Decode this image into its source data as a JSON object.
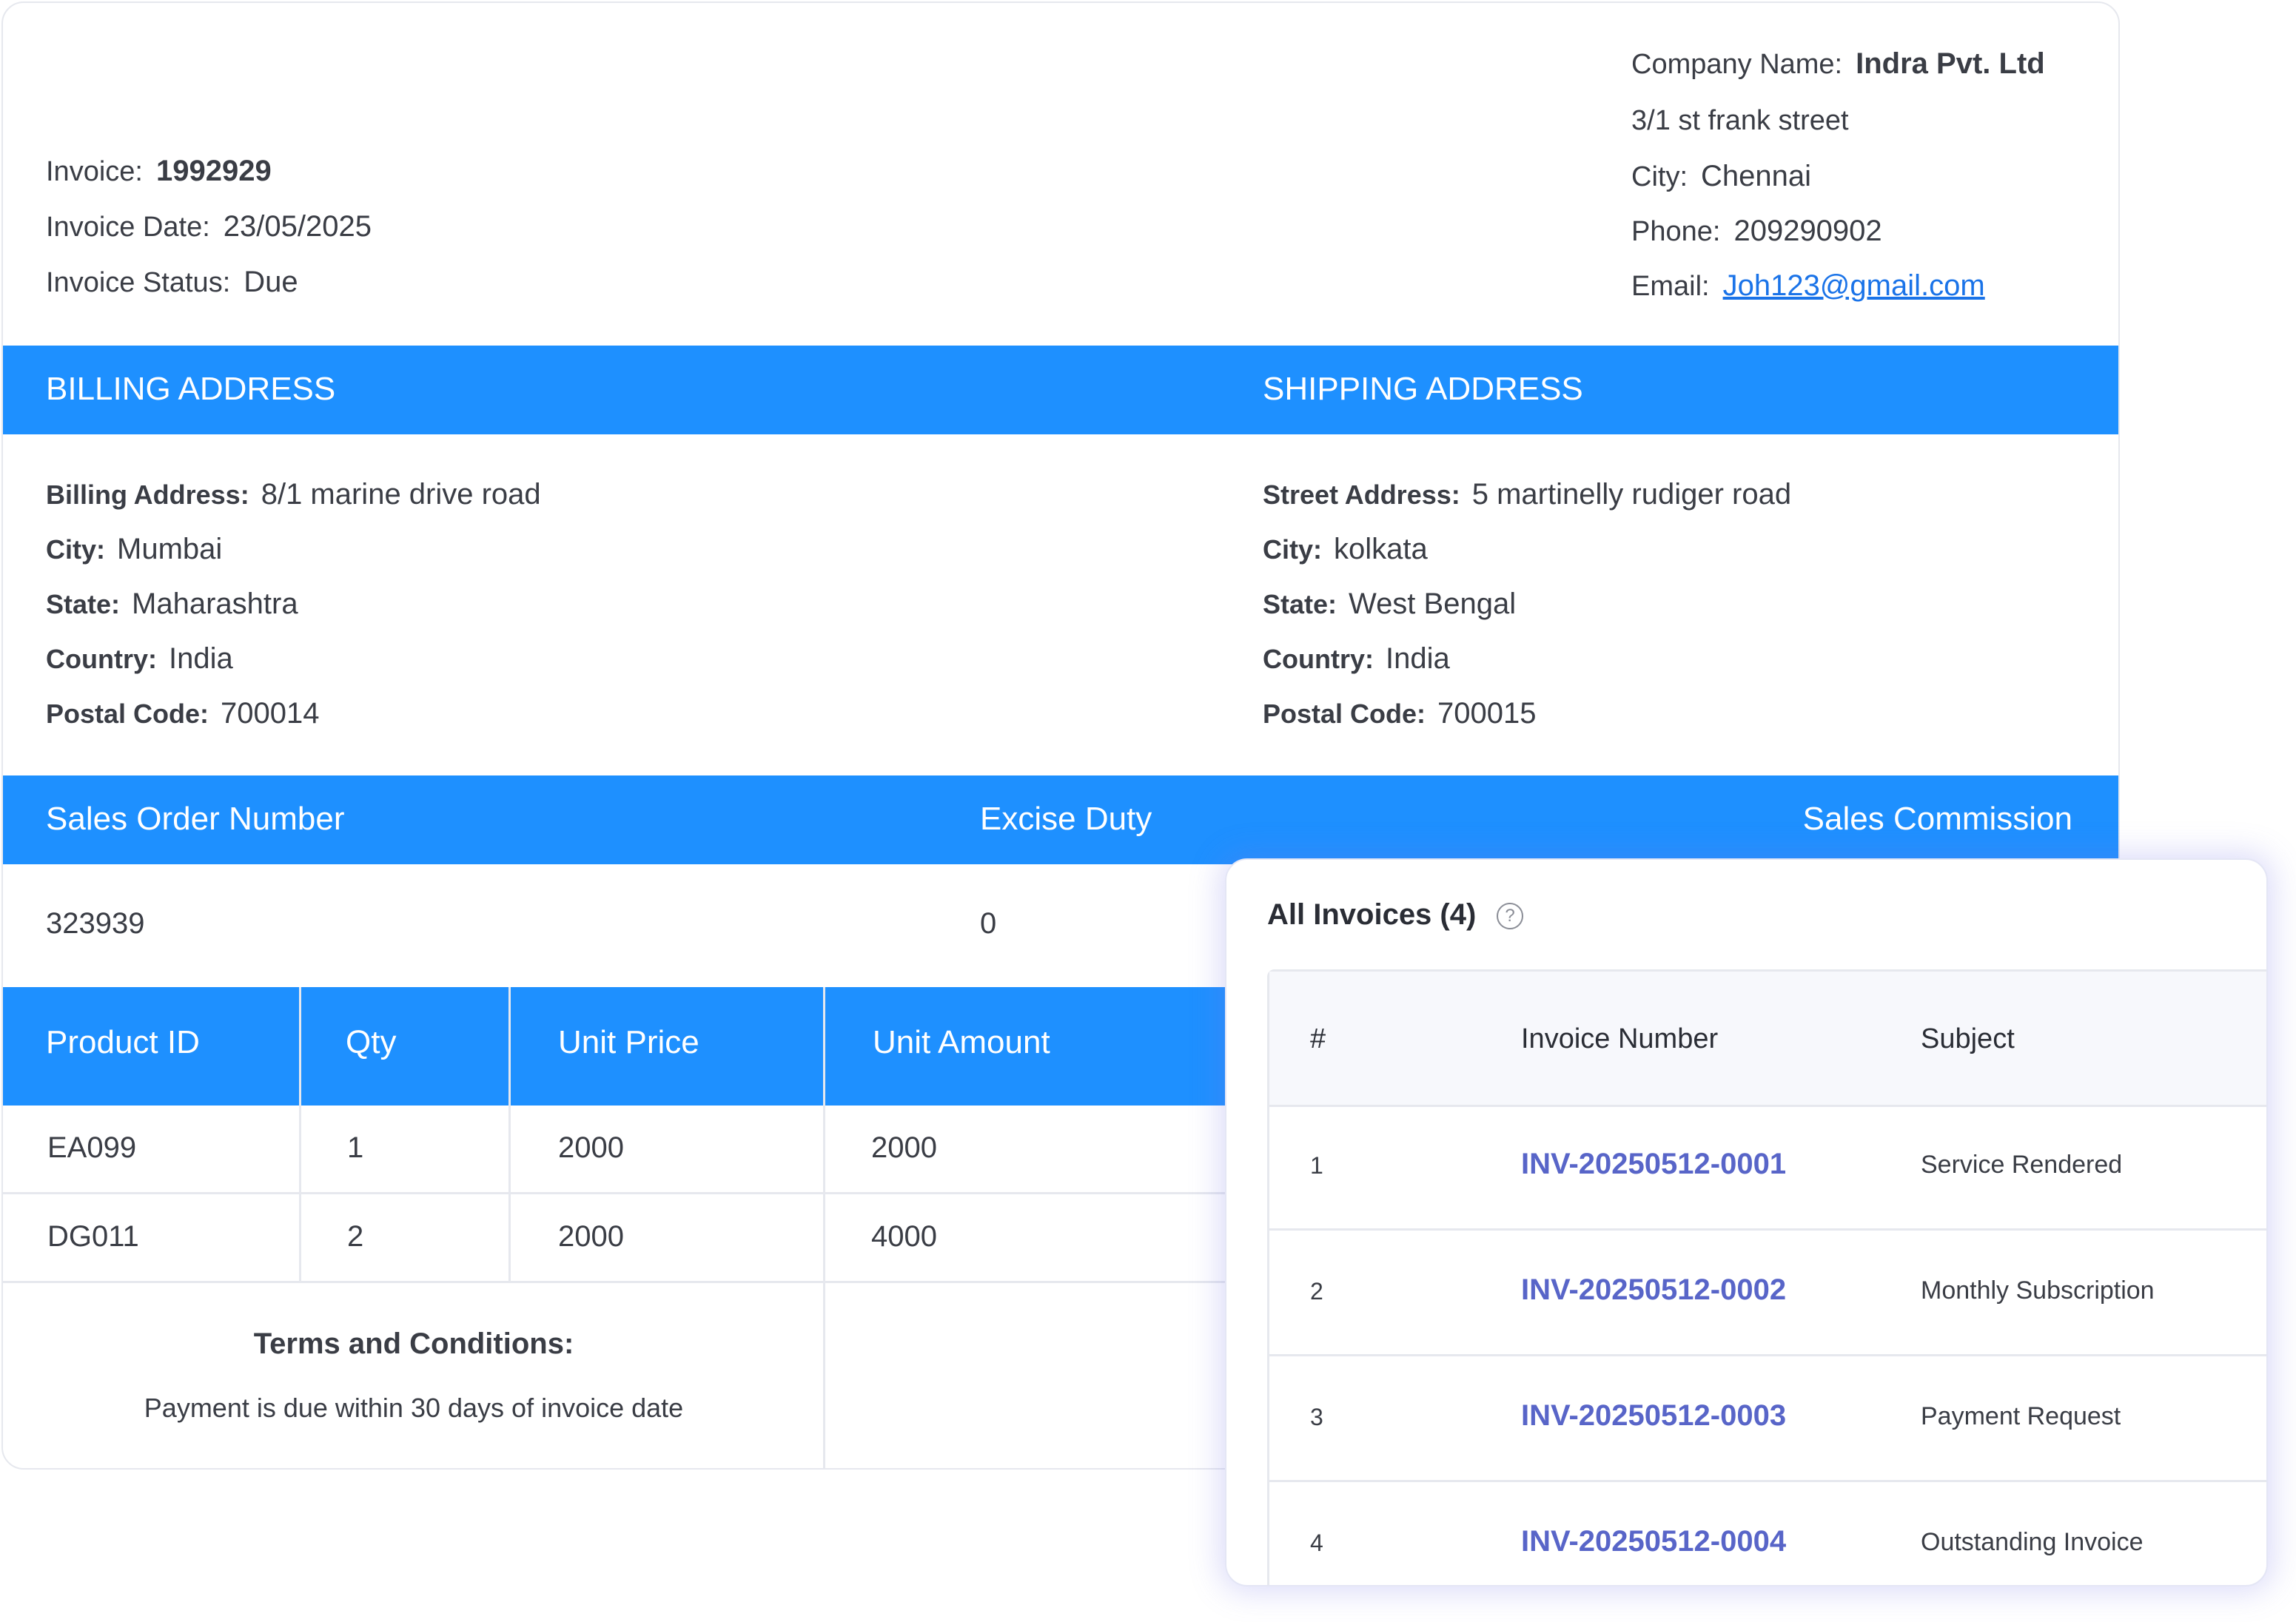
{
  "invoice_info": {
    "invoice_label": "Invoice:",
    "invoice_value": "1992929",
    "date_label": "Invoice Date:",
    "date_value": "23/05/2025",
    "status_label": "Invoice Status:",
    "status_value": "Due"
  },
  "company": {
    "name_label": "Company Name:",
    "name_value": "Indra Pvt. Ltd",
    "street": "3/1 st frank street",
    "city_label": "City:",
    "city_value": "Chennai",
    "phone_label": "Phone:",
    "phone_value": "209290902",
    "email_label": "Email:",
    "email_value": "Joh123@gmail.com"
  },
  "address_band": {
    "billing_title": "BILLING ADDRESS",
    "shipping_title": "SHIPPING ADDRESS"
  },
  "billing": {
    "address_label": "Billing Address:",
    "address_value": "8/1 marine drive road",
    "city_label": "City:",
    "city_value": "Mumbai",
    "state_label": "State:",
    "state_value": "Maharashtra",
    "country_label": "Country:",
    "country_value": "India",
    "postal_label": "Postal Code:",
    "postal_value": "700014"
  },
  "shipping": {
    "address_label": "Street Address:",
    "address_value": "5 martinelly rudiger road",
    "city_label": "City:",
    "city_value": "kolkata",
    "state_label": "State:",
    "state_value": "West Bengal",
    "country_label": "Country:",
    "country_value": "India",
    "postal_label": "Postal Code:",
    "postal_value": "700015"
  },
  "sales_band": {
    "order_header": "Sales Order Number",
    "excise_header": "Excise Duty",
    "commission_header": "Sales Commission",
    "order_value": "323939",
    "excise_value": "0"
  },
  "products": {
    "headers": [
      "Product ID",
      "Qty",
      "Unit Price",
      "Unit Amount"
    ],
    "rows": [
      [
        "EA099",
        "1",
        "2000",
        "2000"
      ],
      [
        "DG011",
        "2",
        "2000",
        "4000"
      ]
    ]
  },
  "terms": {
    "title": "Terms and Conditions:",
    "text": "Payment is due within 30 days of invoice date"
  },
  "all_invoices": {
    "title": "All Invoices (4)",
    "help_icon": "question-circle-icon",
    "headers": [
      "#",
      "Invoice Number",
      "Subject"
    ],
    "rows": [
      {
        "num": "1",
        "invoice": "INV-20250512-0001",
        "subject": "Service Rendered"
      },
      {
        "num": "2",
        "invoice": "INV-20250512-0002",
        "subject": "Monthly Subscription"
      },
      {
        "num": "3",
        "invoice": "INV-20250512-0003",
        "subject": "Payment Request"
      },
      {
        "num": "4",
        "invoice": "INV-20250512-0004",
        "subject": "Outstanding Invoice"
      }
    ]
  },
  "colors": {
    "accent": "#1e90ff",
    "link": "#1a73e8",
    "invoice_link": "#5865c8"
  }
}
